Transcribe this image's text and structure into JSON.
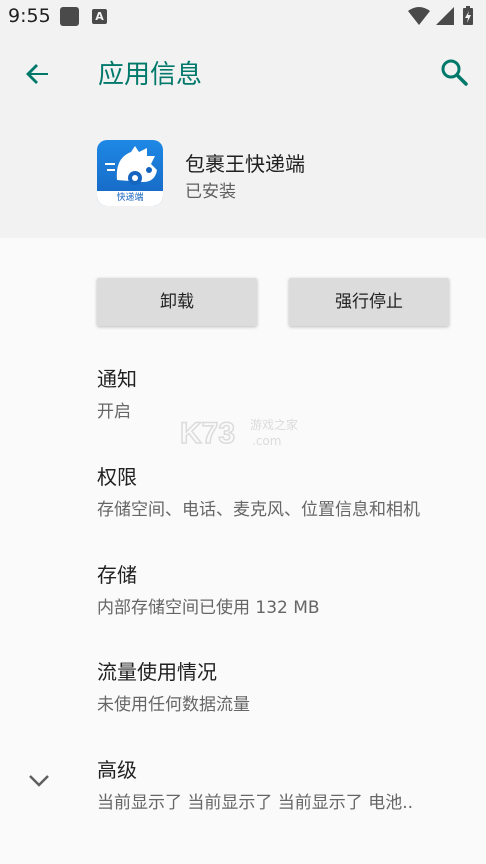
{
  "status_bar": {
    "time": "9:55",
    "notification_letter": "A"
  },
  "header": {
    "title": "应用信息"
  },
  "app": {
    "name": "包裹王快递端",
    "status": "已安装",
    "icon_caption": "快递端"
  },
  "buttons": {
    "uninstall": "卸载",
    "force_stop": "强行停止"
  },
  "preferences": [
    {
      "title": "通知",
      "summary": "开启"
    },
    {
      "title": "权限",
      "summary": "存储空间、电话、麦克风、位置信息和相机"
    },
    {
      "title": "存储",
      "summary": "内部存储空间已使用 132 MB"
    },
    {
      "title": "流量使用情况",
      "summary": "未使用任何数据流量"
    },
    {
      "title": "高级",
      "summary": "当前显示了 当前显示了 当前显示了 电池.."
    }
  ],
  "watermark": {
    "brand": "K73",
    "cn": "游戏之家",
    "domain": ".com"
  },
  "colors": {
    "accent": "#00796b",
    "header_bg": "#f2f2f2",
    "icon_blue": "#1e88e5"
  },
  "icons": [
    "back-arrow-icon",
    "search-icon",
    "wifi-icon",
    "signal-icon",
    "battery-charging-icon",
    "chevron-down-icon"
  ]
}
